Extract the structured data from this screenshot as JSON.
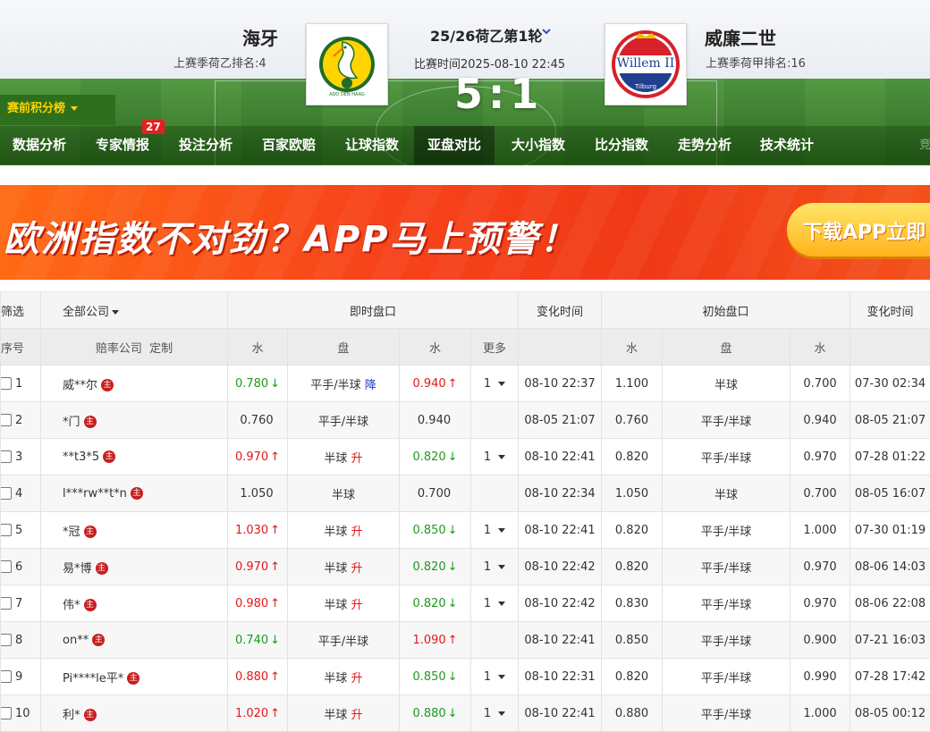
{
  "match": {
    "home": {
      "name": "海牙",
      "sub": "上赛季荷乙排名:4",
      "logo_text": "ADO DEN HAAG"
    },
    "away": {
      "name": "威廉二世",
      "sub": "上赛季荷甲排名:16",
      "logo_text": "Willem II",
      "logo_sub": "Tilburg"
    },
    "round": "25/26荷乙第1轮",
    "time": "比赛时间2025-08-10 22:45",
    "score_home": "5",
    "score_sep": ":",
    "score_away": "1"
  },
  "standings_label": "赛前积分榜",
  "nav": {
    "items": [
      {
        "label": "数据分析"
      },
      {
        "label": "专家情报",
        "badge": "27"
      },
      {
        "label": "投注分析"
      },
      {
        "label": "百家欧赔"
      },
      {
        "label": "让球指数"
      },
      {
        "label": "亚盘对比",
        "active": true
      },
      {
        "label": "大小指数"
      },
      {
        "label": "比分指数"
      },
      {
        "label": "走势分析"
      },
      {
        "label": "技术统计"
      }
    ],
    "overflow": "竞"
  },
  "banner": {
    "text": "欧洲指数不对劲？APP马上预警！",
    "button": "下载APP立即"
  },
  "table": {
    "header1": {
      "filter": "筛选",
      "all_companies": "全部公司",
      "live": "即时盘口",
      "change_time": "变化时间",
      "initial": "初始盘口",
      "change_time2": "变化时间"
    },
    "header2": {
      "seq": "序号",
      "company": "赔率公司",
      "custom": "定制",
      "water": "水",
      "handicap": "盘",
      "water2": "水",
      "more": "更多",
      "iwater": "水",
      "ihandicap": "盘",
      "iwater2": "水"
    },
    "rows": [
      {
        "seq": "1",
        "company": "威**尔",
        "zhu": "主",
        "w1": "0.780",
        "w1c": "green",
        "w1a": "↓",
        "pan": "平手/半球",
        "tag": "降",
        "tagc": "blue",
        "w2": "0.940",
        "w2c": "red",
        "w2a": "↑",
        "more": "1",
        "t1": "08-10 22:37",
        "iw1": "1.100",
        "ipan": "半球",
        "iw2": "0.700",
        "t2": "07-30 02:34"
      },
      {
        "seq": "2",
        "company": "*门",
        "zhu": "主",
        "w1": "0.760",
        "w1c": "",
        "w1a": "",
        "pan": "平手/半球",
        "tag": "",
        "tagc": "",
        "w2": "0.940",
        "w2c": "",
        "w2a": "",
        "more": "",
        "t1": "08-05 21:07",
        "iw1": "0.760",
        "ipan": "平手/半球",
        "iw2": "0.940",
        "t2": "08-05 21:07"
      },
      {
        "seq": "3",
        "company": "**t3*5",
        "zhu": "主",
        "w1": "0.970",
        "w1c": "red",
        "w1a": "↑",
        "pan": "半球",
        "tag": "升",
        "tagc": "red",
        "w2": "0.820",
        "w2c": "green",
        "w2a": "↓",
        "more": "1",
        "t1": "08-10 22:41",
        "iw1": "0.820",
        "ipan": "平手/半球",
        "iw2": "0.970",
        "t2": "07-28 01:22"
      },
      {
        "seq": "4",
        "company": "l***rw**t*n",
        "zhu": "主",
        "w1": "1.050",
        "w1c": "",
        "w1a": "",
        "pan": "半球",
        "tag": "",
        "tagc": "",
        "w2": "0.700",
        "w2c": "",
        "w2a": "",
        "more": "",
        "t1": "08-10 22:34",
        "iw1": "1.050",
        "ipan": "半球",
        "iw2": "0.700",
        "t2": "08-05 16:07"
      },
      {
        "seq": "5",
        "company": "*冠",
        "zhu": "主",
        "w1": "1.030",
        "w1c": "red",
        "w1a": "↑",
        "pan": "半球",
        "tag": "升",
        "tagc": "red",
        "w2": "0.850",
        "w2c": "green",
        "w2a": "↓",
        "more": "1",
        "t1": "08-10 22:41",
        "iw1": "0.820",
        "ipan": "平手/半球",
        "iw2": "1.000",
        "t2": "07-30 01:19"
      },
      {
        "seq": "6",
        "company": "易*博",
        "zhu": "主",
        "w1": "0.970",
        "w1c": "red",
        "w1a": "↑",
        "pan": "半球",
        "tag": "升",
        "tagc": "red",
        "w2": "0.820",
        "w2c": "green",
        "w2a": "↓",
        "more": "1",
        "t1": "08-10 22:42",
        "iw1": "0.820",
        "ipan": "平手/半球",
        "iw2": "0.970",
        "t2": "08-06 14:03"
      },
      {
        "seq": "7",
        "company": "伟*",
        "zhu": "主",
        "w1": "0.980",
        "w1c": "red",
        "w1a": "↑",
        "pan": "半球",
        "tag": "升",
        "tagc": "red",
        "w2": "0.820",
        "w2c": "green",
        "w2a": "↓",
        "more": "1",
        "t1": "08-10 22:42",
        "iw1": "0.830",
        "ipan": "平手/半球",
        "iw2": "0.970",
        "t2": "08-06 22:08"
      },
      {
        "seq": "8",
        "company": "on**",
        "zhu": "主",
        "w1": "0.740",
        "w1c": "green",
        "w1a": "↓",
        "pan": "平手/半球",
        "tag": "",
        "tagc": "",
        "w2": "1.090",
        "w2c": "red",
        "w2a": "↑",
        "more": "",
        "t1": "08-10 22:41",
        "iw1": "0.850",
        "ipan": "平手/半球",
        "iw2": "0.900",
        "t2": "07-21 16:03"
      },
      {
        "seq": "9",
        "company": "Pi****le平*",
        "zhu": "主",
        "w1": "0.880",
        "w1c": "red",
        "w1a": "↑",
        "pan": "半球",
        "tag": "升",
        "tagc": "red",
        "w2": "0.850",
        "w2c": "green",
        "w2a": "↓",
        "more": "1",
        "t1": "08-10 22:31",
        "iw1": "0.820",
        "ipan": "平手/半球",
        "iw2": "0.990",
        "t2": "07-28 17:42"
      },
      {
        "seq": "10",
        "company": "利*",
        "zhu": "主",
        "w1": "1.020",
        "w1c": "red",
        "w1a": "↑",
        "pan": "半球",
        "tag": "升",
        "tagc": "red",
        "w2": "0.880",
        "w2c": "green",
        "w2a": "↓",
        "more": "1",
        "t1": "08-10 22:41",
        "iw1": "0.880",
        "ipan": "平手/半球",
        "iw2": "1.000",
        "t2": "08-05 00:12"
      }
    ]
  }
}
